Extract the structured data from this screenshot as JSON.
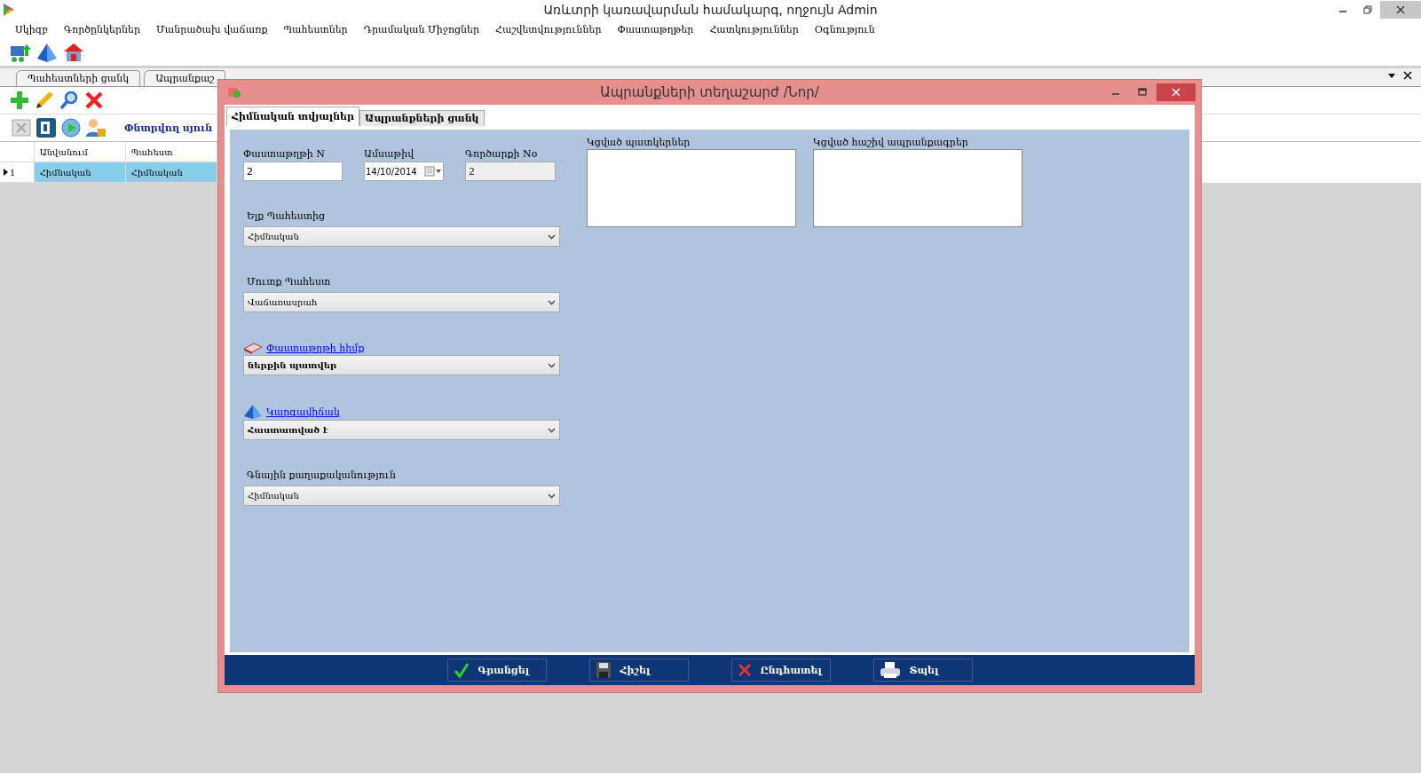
{
  "window": {
    "title": "Առևտրի կառավարման համակարգ, ողջույն Admin"
  },
  "menu": [
    "Սկիզբ",
    "Գործընկերներ",
    "Մանրածախ վաճառք",
    "Պահեստներ",
    "Դրամական Միջոցներ",
    "Հաշվետվություններ",
    "Փաստաթղթեր",
    "Հատկություններ",
    "Օգնություն"
  ],
  "tabs": [
    {
      "label": "Պահեստների ցանկ",
      "selected": false
    },
    {
      "label": "Ապրանքաշ",
      "selected": false
    }
  ],
  "search_label": "Փնտրվող սյուն",
  "table": {
    "columns": [
      "Անվանում",
      "Պահեստ"
    ],
    "rows": [
      {
        "number": "1",
        "cells": [
          "Հիմնական",
          "Հիմնական"
        ],
        "selected": true
      }
    ]
  },
  "dialog": {
    "title": "Ապրանքների տեղաշարժ /Նոր/",
    "tabs": [
      {
        "label": "Հիմնական տվյալներ",
        "selected": true
      },
      {
        "label": "Ապրանքների ցանկ",
        "selected": false
      }
    ],
    "doc_number": {
      "label": "Փաստաթղթի N",
      "value": "2"
    },
    "date": {
      "label": "Ամսաթիվ",
      "value": "14/10/2014"
    },
    "deal_number": {
      "label": "Գործարքի No",
      "value": "2",
      "disabled": true
    },
    "selects": [
      {
        "label": "Ելք Պահեստից",
        "value": "Հիմնական",
        "kind": "plain",
        "bold": false
      },
      {
        "label": "Մուտք Պահեստ",
        "value": "Վաճառասրահ",
        "kind": "plain",
        "bold": false
      },
      {
        "label": "Փաստաթղթի հիմք",
        "value": "ներքին պատվեր",
        "kind": "book",
        "bold": true
      },
      {
        "label": "Կարգավիճակ",
        "value": "Հաստատված է",
        "kind": "pyramid",
        "bold": true
      },
      {
        "label": "Գնային քաղաքականություն",
        "value": "Հիմնական",
        "kind": "plain",
        "bold": false
      }
    ],
    "attachments": [
      {
        "label": "Կցված պատկերներ"
      },
      {
        "label": "Կցված հաշիվ ապրանքագրեր"
      }
    ],
    "buttons": [
      {
        "label": "Գրանցել",
        "kind": "check"
      },
      {
        "label": "Հիշել",
        "kind": "save"
      },
      {
        "label": "Ընդհատել",
        "kind": "cancel"
      },
      {
        "label": "Տպել",
        "kind": "print"
      }
    ]
  }
}
